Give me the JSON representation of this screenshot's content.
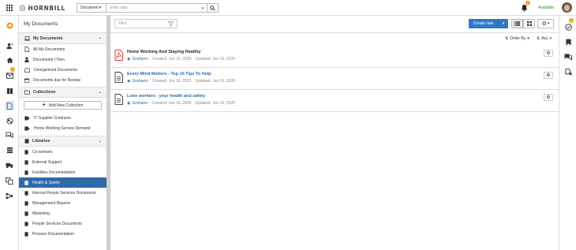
{
  "header": {
    "logo": "HORNBILL",
    "search_type": "Document",
    "search_placeholder": "Enter tags",
    "notification_count": "4",
    "status": "Available"
  },
  "leftbar": {
    "mail_badge": "3",
    "icons": [
      "star-icon",
      "user-add-icon",
      "home-icon",
      "mail-icon",
      "book-icon",
      "doc-icon",
      "world-icon",
      "chat-icon",
      "stack-icon",
      "truck-icon",
      "cards-icon",
      "org-icon"
    ]
  },
  "sidebar": {
    "title": "My Documents",
    "my_documents": {
      "header": "My Documents",
      "items": [
        "All My Documents",
        "Documents I Own",
        "Unorganised Documents",
        "Documents due for Review"
      ]
    },
    "collections": {
      "header": "Collections",
      "new_button": "Add New Collection",
      "items": [
        "IT Supplier Contracts",
        "Home Working Service Demand"
      ]
    },
    "libraries": {
      "header": "Libraries",
      "items": [
        "Co-workers",
        "External Support",
        "Facilities Documentation",
        "Health & Safety",
        "Internal People Services Documents",
        "Management Reports",
        "Marketing",
        "People Services Documents",
        "Process Documentation"
      ],
      "active": "Health & Safety"
    }
  },
  "main": {
    "filter_placeholder": "Filter",
    "create_button": "Create new",
    "order_by": "Order By",
    "sort_dir": "Asc",
    "documents": [
      {
        "title": "Home Working And Staying Healthy",
        "author": "Grahamc",
        "created": "Created: Jun 16, 2020",
        "updated": "Updated: Jun 16, 2020",
        "type": "pdf"
      },
      {
        "title": "Every Mind Matters - Top 10 Tips To Help",
        "author": "Grahamc",
        "created": "Created: Jun 16, 2020",
        "updated": "Updated: Jun 16, 2020",
        "type": "doc"
      },
      {
        "title": "Lone workers - your health and safety",
        "author": "Grahamc",
        "created": "Created: Jun 16, 2020",
        "updated": "Updated: Jun 16, 2020",
        "type": "doc"
      }
    ]
  },
  "rightbar": {
    "badge": "4"
  },
  "colors": {
    "accent": "#2e7bc4",
    "active_item": "#2e6aa8",
    "badge": "#f0a30a",
    "pdf_red": "#d9463a",
    "status_green": "#2e8b2e"
  }
}
